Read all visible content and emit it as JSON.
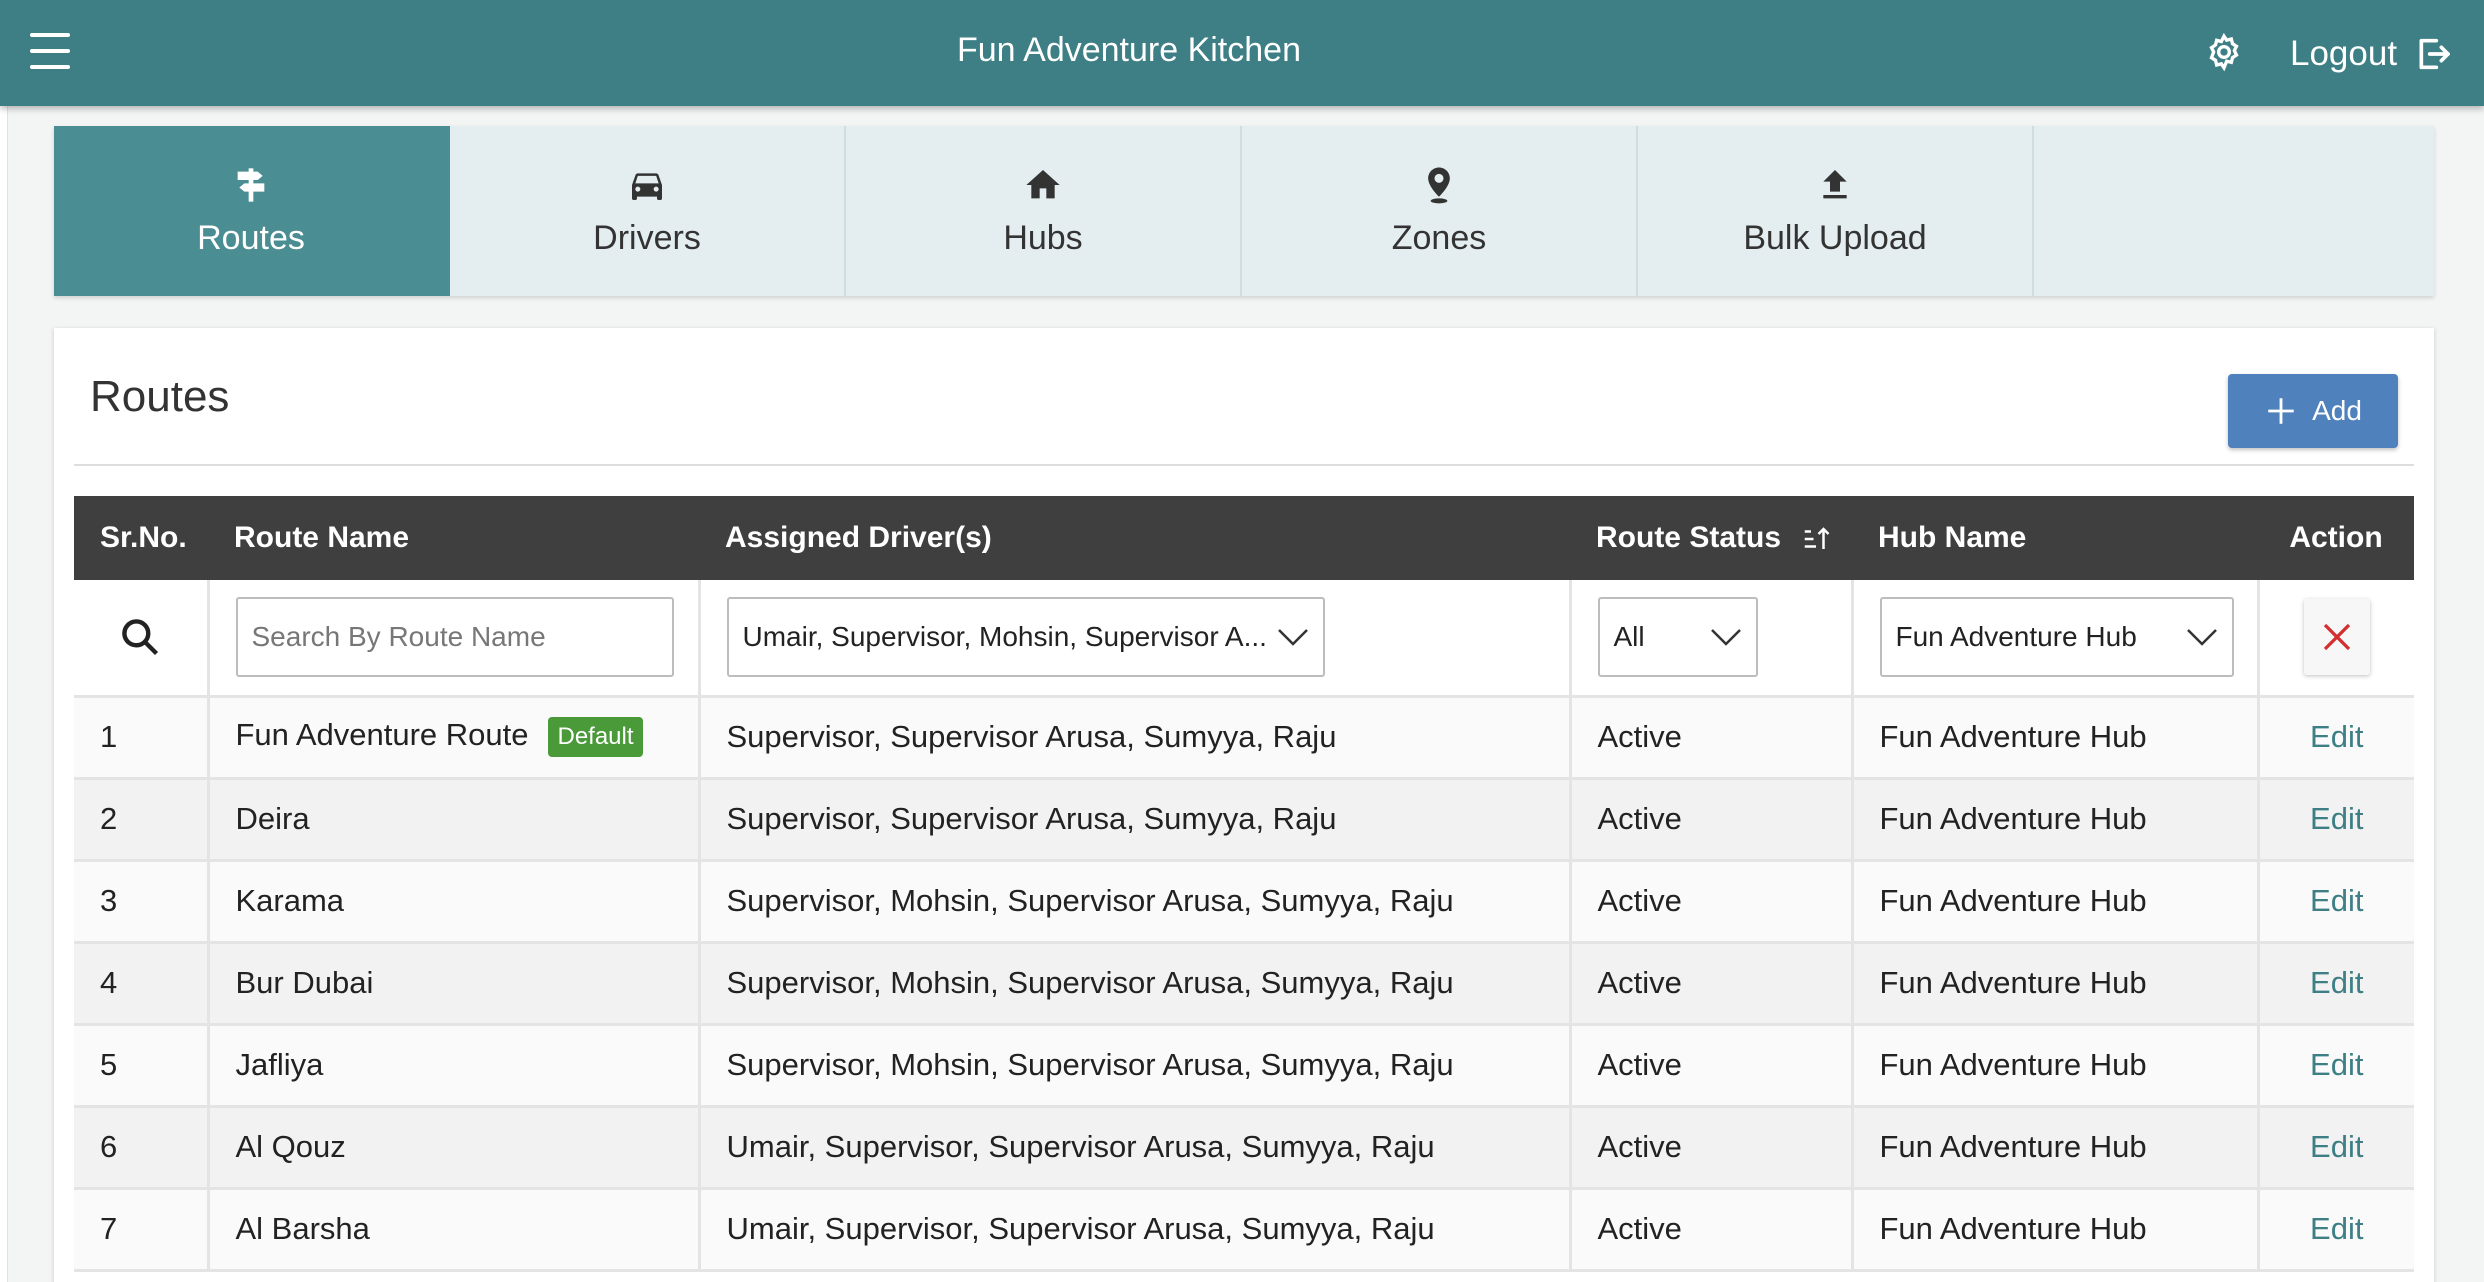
{
  "header": {
    "title": "Fun Adventure Kitchen",
    "logout_label": "Logout"
  },
  "tabs": [
    {
      "label": "Routes",
      "icon": "signpost-icon",
      "active": true
    },
    {
      "label": "Drivers",
      "icon": "car-icon",
      "active": false
    },
    {
      "label": "Hubs",
      "icon": "home-icon",
      "active": false
    },
    {
      "label": "Zones",
      "icon": "location-pin-icon",
      "active": false
    },
    {
      "label": "Bulk Upload",
      "icon": "upload-icon",
      "active": false
    }
  ],
  "card": {
    "title": "Routes",
    "add_label": "Add"
  },
  "table": {
    "columns": [
      "Sr.No.",
      "Route Name",
      "Assigned Driver(s)",
      "Route Status",
      "Hub Name",
      "Action"
    ],
    "filters": {
      "route_name_placeholder": "Search By Route Name",
      "drivers_selected": "Umair, Supervisor, Mohsin, Supervisor A...",
      "status_selected": "All",
      "hub_selected": "Fun Adventure Hub"
    },
    "default_badge": "Default",
    "edit_label": "Edit",
    "rows": [
      {
        "sr": "1",
        "route": "Fun Adventure Route",
        "drivers": "Supervisor, Supervisor Arusa, Sumyya, Raju",
        "status": "Active",
        "hub": "Fun Adventure Hub"
      },
      {
        "sr": "2",
        "route": "Deira",
        "drivers": "Supervisor, Supervisor Arusa, Sumyya, Raju",
        "status": "Active",
        "hub": "Fun Adventure Hub"
      },
      {
        "sr": "3",
        "route": "Karama",
        "drivers": "Supervisor, Mohsin, Supervisor Arusa, Sumyya, Raju",
        "status": "Active",
        "hub": "Fun Adventure Hub"
      },
      {
        "sr": "4",
        "route": "Bur Dubai",
        "drivers": "Supervisor, Mohsin, Supervisor Arusa, Sumyya, Raju",
        "status": "Active",
        "hub": "Fun Adventure Hub"
      },
      {
        "sr": "5",
        "route": "Jafliya",
        "drivers": "Supervisor, Mohsin, Supervisor Arusa, Sumyya, Raju",
        "status": "Active",
        "hub": "Fun Adventure Hub"
      },
      {
        "sr": "6",
        "route": "Al Qouz",
        "drivers": "Umair, Supervisor, Supervisor Arusa, Sumyya, Raju",
        "status": "Active",
        "hub": "Fun Adventure Hub"
      },
      {
        "sr": "7",
        "route": "Al Barsha",
        "drivers": "Umair, Supervisor, Supervisor Arusa, Sumyya, Raju",
        "status": "Active",
        "hub": "Fun Adventure Hub"
      }
    ]
  },
  "colors": {
    "header_bg": "#3d7f85",
    "active_tab_bg": "#4a8d92",
    "add_button_bg": "#4f81bd",
    "default_badge_bg": "#4a9a3a",
    "table_header_bg": "#3f3f3f",
    "clear_icon": "#d32f2f"
  }
}
